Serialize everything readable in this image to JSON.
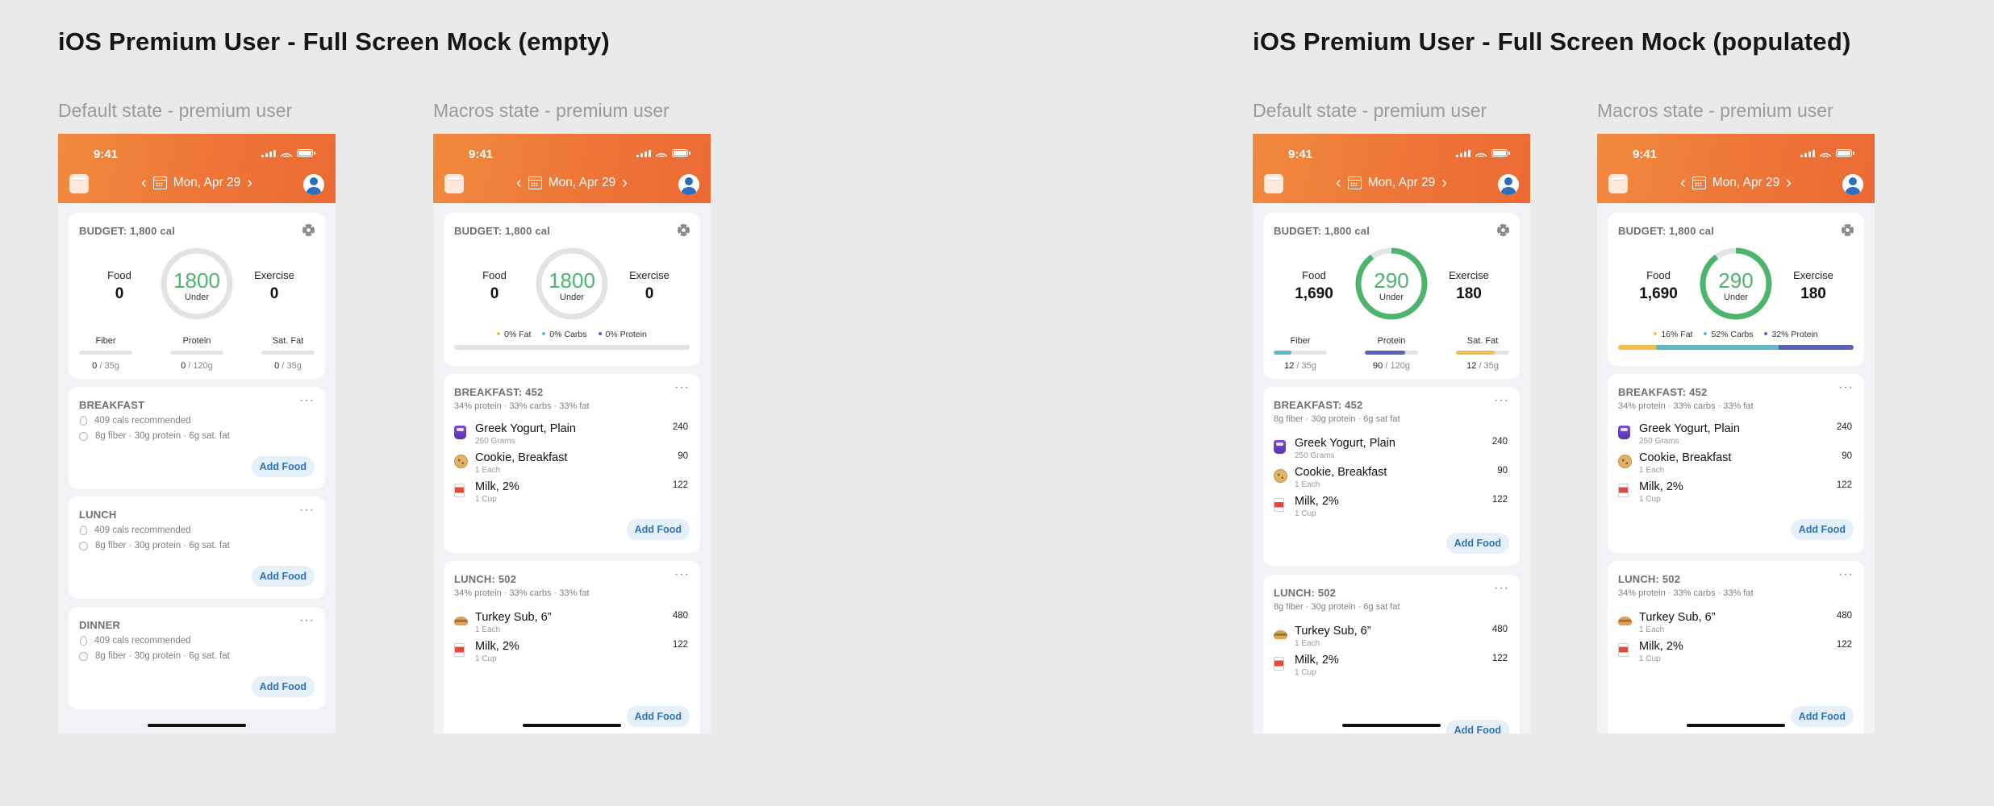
{
  "titles": {
    "empty": "iOS Premium User - Full Screen Mock (empty)",
    "populated": "iOS Premium User - Full Screen Mock (populated)"
  },
  "phones": [
    {
      "state_label": "Default state - premium user",
      "time": "9:41",
      "date": "Mon, Apr 29",
      "budget": "BUDGET: 1,800 cal",
      "food_label": "Food",
      "food": "0",
      "ring_value": "1800",
      "ring_sub": "Under",
      "ring_fill": 0,
      "exercise_label": "Exercise",
      "exercise": "0",
      "fiber_label": "Fiber",
      "fiber_val": "0",
      "fiber_goal": " / 35g",
      "protein_label": "Protein",
      "protein_val": "0",
      "protein_goal": " / 120g",
      "satfat_label": "Sat. Fat",
      "satfat_val": "0",
      "satfat_goal": " / 35g",
      "meals": [
        {
          "title": "BREAKFAST",
          "rec1": "409 cals recommended",
          "rec2": "8g fiber · 30g protein · 6g sat. fat",
          "add": "Add Food"
        },
        {
          "title": "LUNCH",
          "rec1": "409 cals recommended",
          "rec2": "8g fiber · 30g protein · 6g sat. fat",
          "add": "Add Food"
        },
        {
          "title": "DINNER",
          "rec1": "409 cals recommended",
          "rec2": "8g fiber · 30g protein · 6g sat. fat",
          "add": "Add Food"
        }
      ]
    },
    {
      "state_label": "Macros state - premium user",
      "time": "9:41",
      "date": "Mon, Apr 29",
      "budget": "BUDGET: 1,800 cal",
      "food_label": "Food",
      "food": "0",
      "ring_value": "1800",
      "ring_sub": "Under",
      "ring_fill": 0,
      "exercise_label": "Exercise",
      "exercise": "0",
      "macros": {
        "fat": "0% Fat",
        "carbs": "0% Carbs",
        "protein": "0% Protein"
      },
      "breakfast": {
        "title": "BREAKFAST: 452",
        "sub": "34% protein · 33% carbs · 33% fat"
      },
      "lunch": {
        "title": "LUNCH: 502",
        "sub": "34% protein · 33% carbs · 33% fat"
      },
      "add": "Add Food"
    },
    {
      "state_label": "Default state - premium user",
      "time": "9:41",
      "date": "Mon, Apr 29",
      "budget": "BUDGET: 1,800 cal",
      "food_label": "Food",
      "food": "1,690",
      "ring_value": "290",
      "ring_sub": "Under",
      "ring_fill": 0.9,
      "exercise_label": "Exercise",
      "exercise": "180",
      "fiber_label": "Fiber",
      "fiber_val": "12",
      "fiber_goal": " / 35g",
      "fiber_fill": 0.34,
      "protein_label": "Protein",
      "protein_val": "90",
      "protein_goal": " / 120g",
      "protein_fill": 0.75,
      "satfat_label": "Sat. Fat",
      "satfat_val": "12",
      "satfat_goal": " / 35g",
      "satfat_fill": 0.72,
      "breakfast": {
        "title": "BREAKFAST: 452",
        "sub": "8g fiber · 30g protein · 6g sat fat"
      },
      "lunch": {
        "title": "LUNCH: 502",
        "sub": "8g fiber · 30g protein · 6g sat fat"
      },
      "add": "Add Food"
    },
    {
      "state_label": "Macros state - premium user",
      "time": "9:41",
      "date": "Mon, Apr 29",
      "budget": "BUDGET: 1,800 cal",
      "food_label": "Food",
      "food": "1,690",
      "ring_value": "290",
      "ring_sub": "Under",
      "ring_fill": 0.9,
      "exercise_label": "Exercise",
      "exercise": "180",
      "macros": {
        "fat": "16% Fat",
        "carbs": "52% Carbs",
        "protein": "32% Protein"
      },
      "breakfast": {
        "title": "BREAKFAST: 452",
        "sub": "34% protein · 33% carbs · 33% fat"
      },
      "lunch": {
        "title": "LUNCH: 502",
        "sub": "34% protein · 33% carbs · 33% fat"
      },
      "add": "Add Food"
    }
  ],
  "foods": {
    "yogurt": {
      "name": "Greek Yogurt, Plain",
      "portion": "250 Grams",
      "cal": "240"
    },
    "cookie": {
      "name": "Cookie, Breakfast",
      "portion": "1 Each",
      "cal": "90"
    },
    "milk": {
      "name": "Milk, 2%",
      "portion": "1 Cup",
      "cal": "122"
    },
    "sub": {
      "name": "Turkey Sub, 6”",
      "portion": "1 Each",
      "cal": "480"
    }
  },
  "colors": {
    "header_orange": "#ee7537",
    "ring_green": "#4cb46c",
    "fat": "#f2c04a",
    "carbs": "#62b8c9",
    "protein": "#5a62b8",
    "add_button": "#2f73b9"
  }
}
